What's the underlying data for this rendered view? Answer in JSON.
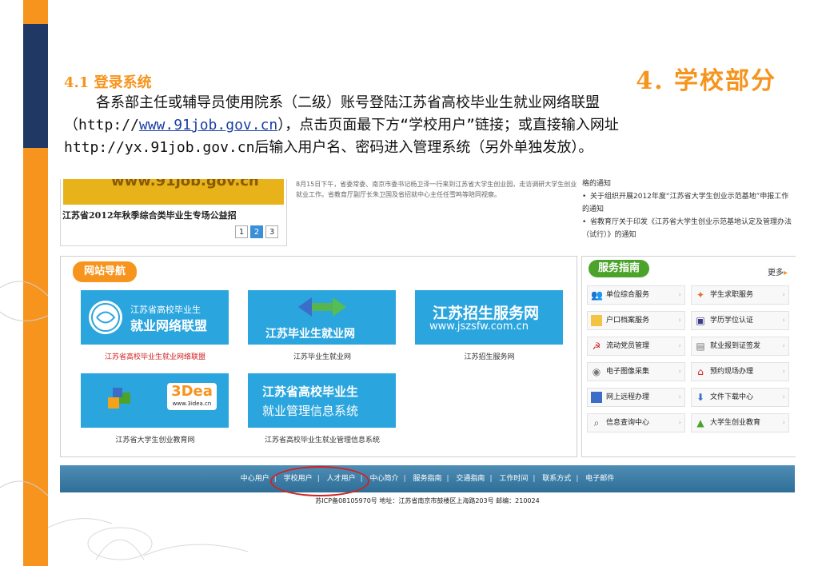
{
  "slide": {
    "section_title": "4. 学校部分",
    "sub_title": "4.1 登录系统",
    "line1": "各系部主任或辅导员使用院系（二级）账号登陆江苏省高校毕业生就业网络联盟",
    "line2_prefix": "（http://",
    "line2_link": "www.91job.gov.cn",
    "line2_suffix": "），点击页面最下方“学校用户”链接；或直接输入网址",
    "line3": "http://yx.91job.gov.cn后输入用户名、密码进入管理系统（另外单独发放）。"
  },
  "screenshot": {
    "news_left": {
      "banner_text": "www.91job.gov.cn",
      "title": "江苏省2012年秋季综合类毕业生专场公益招",
      "pages": [
        "1",
        "2",
        "3"
      ],
      "active_page": "2"
    },
    "news_mid": "8月15日下午，省委常委、南京市委书记杨卫泽一行来到江苏省大学生创业园，走访调研大学生创业就业工作。省教育厅副厅长朱卫国及省招就中心主任任雪鸣等陪同视察。",
    "news_right": {
      "top": "格的通知",
      "items": [
        "关于组织开展2012年度“江苏省大学生创业示范基地”申报工作的通知",
        "省教育厅关于印发《江苏省大学生创业示范基地认定及管理办法（试行）》的通知"
      ]
    },
    "nav_panel": {
      "title": "网站导航",
      "links": [
        {
          "tile_line1": "江苏省高校毕业生",
          "tile_line2": "就业网络联盟",
          "caption": "江苏省高校毕业生就业网络联盟"
        },
        {
          "tile_line1": "江苏毕业生就业网",
          "caption": "江苏毕业生就业网"
        },
        {
          "tile_line1": "江苏招生服务网",
          "tile_line2": "www.jszsfw.com.cn",
          "caption": "江苏招生服务网"
        },
        {
          "tile_line1": "3Dea",
          "tile_line2": "www.3idea.cn",
          "caption": "江苏省大学生创业教育网"
        },
        {
          "tile_line1": "江苏省高校毕业生",
          "tile_line2": "就业管理信息系统",
          "caption": "江苏省高校毕业生就业管理信息系统"
        }
      ]
    },
    "service_panel": {
      "title": "服务指南",
      "more": "更多",
      "items": [
        {
          "label": "单位综合服务",
          "icon": "people-icon"
        },
        {
          "label": "学生求职服务",
          "icon": "student-icon"
        },
        {
          "label": "户口档案服务",
          "icon": "folder-icon"
        },
        {
          "label": "学历学位认证",
          "icon": "certificate-icon"
        },
        {
          "label": "流动党员管理",
          "icon": "party-icon"
        },
        {
          "label": "就业报到证签发",
          "icon": "document-icon"
        },
        {
          "label": "电子图像采集",
          "icon": "camera-icon"
        },
        {
          "label": "预约现场办理",
          "icon": "house-icon"
        },
        {
          "label": "网上远程办理",
          "icon": "monitor-icon"
        },
        {
          "label": "文件下载中心",
          "icon": "download-icon"
        },
        {
          "label": "信息查询中心",
          "icon": "search-icon"
        },
        {
          "label": "大学生创业教育",
          "icon": "chart-icon"
        }
      ]
    },
    "footer": {
      "links": [
        "中心用户",
        "学校用户",
        "人才用户",
        "中心简介",
        "服务指南",
        "交通指南",
        "工作时间",
        "联系方式",
        "电子邮件"
      ],
      "info": "苏ICP备08105970号  地址：江苏省南京市鼓楼区上海路203号  邮编：210024"
    }
  },
  "colors": {
    "accent_orange": "#f7941d",
    "navy": "#1f3864",
    "tile_blue": "#2aa5de",
    "service_green": "#4ca32b",
    "highlight_red": "#d52020"
  }
}
